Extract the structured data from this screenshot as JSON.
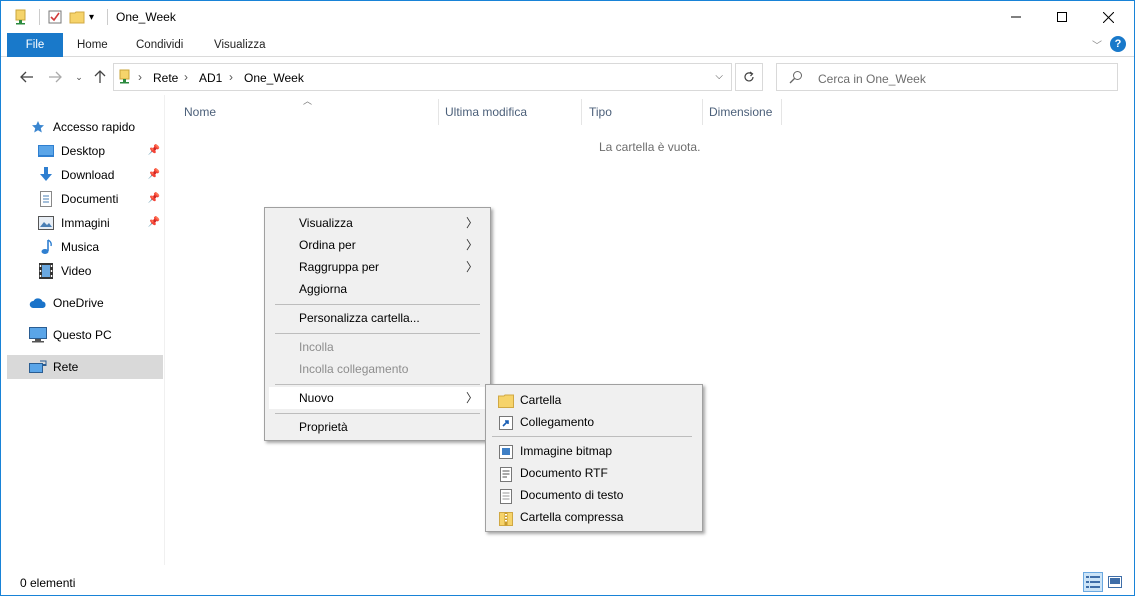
{
  "window": {
    "title": "One_Week"
  },
  "ribbon": {
    "tabs": [
      "File",
      "Home",
      "Condividi",
      "Visualizza"
    ]
  },
  "address": {
    "crumbs": [
      "Rete",
      "AD1",
      "One_Week"
    ]
  },
  "search": {
    "placeholder": "Cerca in One_Week"
  },
  "sidebar": {
    "items": [
      {
        "label": "Accesso rapido",
        "icon": "star-icon"
      },
      {
        "label": "Desktop",
        "icon": "desktop-icon",
        "pinned": true
      },
      {
        "label": "Download",
        "icon": "download-icon",
        "pinned": true
      },
      {
        "label": "Documenti",
        "icon": "documents-icon",
        "pinned": true
      },
      {
        "label": "Immagini",
        "icon": "pictures-icon",
        "pinned": true
      },
      {
        "label": "Musica",
        "icon": "music-icon"
      },
      {
        "label": "Video",
        "icon": "video-icon"
      },
      {
        "label": "OneDrive",
        "icon": "onedrive-icon"
      },
      {
        "label": "Questo PC",
        "icon": "computer-icon"
      },
      {
        "label": "Rete",
        "icon": "network-icon",
        "selected": true
      }
    ]
  },
  "columns": {
    "name": "Nome",
    "modified": "Ultima modifica",
    "type": "Tipo",
    "size": "Dimensione"
  },
  "content": {
    "empty_message": "La cartella è vuota."
  },
  "context_menu": {
    "items": [
      {
        "label": "Visualizza",
        "submenu": true
      },
      {
        "label": "Ordina per",
        "submenu": true
      },
      {
        "label": "Raggruppa per",
        "submenu": true
      },
      {
        "label": "Aggiorna"
      },
      {
        "label": "Personalizza cartella..."
      },
      {
        "label": "Incolla",
        "disabled": true
      },
      {
        "label": "Incolla collegamento",
        "disabled": true
      },
      {
        "label": "Nuovo",
        "submenu": true,
        "highlighted": true
      },
      {
        "label": "Proprietà"
      }
    ]
  },
  "new_submenu": {
    "items": [
      {
        "label": "Cartella",
        "icon": "folder-icon"
      },
      {
        "label": "Collegamento",
        "icon": "shortcut-icon"
      },
      {
        "label": "Immagine bitmap",
        "icon": "bitmap-icon"
      },
      {
        "label": "Documento RTF",
        "icon": "rtf-icon"
      },
      {
        "label": "Documento di testo",
        "icon": "text-document-icon"
      },
      {
        "label": "Cartella compressa",
        "icon": "zip-folder-icon"
      }
    ]
  },
  "status": {
    "item_count": "0 elementi"
  },
  "colors": {
    "accent": "#1979ca",
    "selection": "#d9d9d9",
    "menu_bg": "#f0f0f0"
  }
}
